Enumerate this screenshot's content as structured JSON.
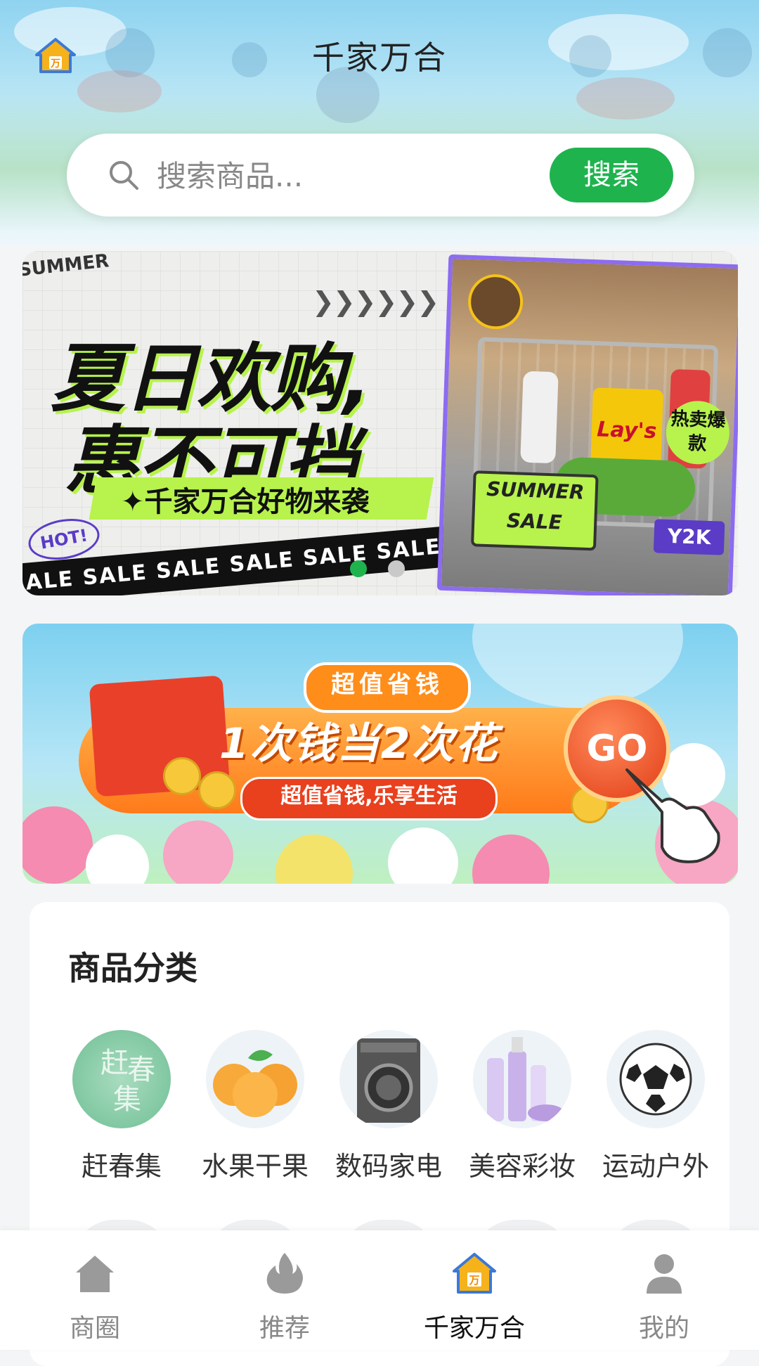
{
  "header": {
    "title": "千家万合",
    "logo_icon": "app-logo-icon"
  },
  "search": {
    "placeholder": "搜索商品...",
    "button_label": "搜索",
    "icon": "search-icon"
  },
  "banner_summer": {
    "tag": "SUMMER",
    "headline_line1": "夏日欢购,",
    "headline_line2": "惠不可挡",
    "subline": "✦千家万合好物来袭",
    "hot_badge": "HOT!",
    "tape_text": "SALE  SALE  SALE  SALE  SALE  SALE",
    "sign_text": "SUMMER SALE",
    "burst_text": "热卖爆款",
    "y2k_badge": "Y2K",
    "chip_brand": "Lay's",
    "accent_color": "#b7f34c",
    "frame_color": "#8c6cf0"
  },
  "carousel": {
    "slide_count": 2,
    "active_index": 0,
    "active_color": "#1fb34e",
    "inactive_color": "#c9c9c9"
  },
  "banner_save": {
    "top_badge": "超值省钱",
    "slogan": "1次钱当2次花",
    "sub_badge": "超值省钱,乐享生活",
    "go_label": "GO"
  },
  "categories": {
    "title": "商品分类",
    "items": [
      {
        "label": "赶春集",
        "icon": "spring-market-icon"
      },
      {
        "label": "水果干果",
        "icon": "fruit-icon"
      },
      {
        "label": "数码家电",
        "icon": "washing-machine-icon"
      },
      {
        "label": "美容彩妆",
        "icon": "cosmetics-icon"
      },
      {
        "label": "运动户外",
        "icon": "soccer-ball-icon"
      }
    ]
  },
  "tabbar": {
    "items": [
      {
        "label": "商圈",
        "icon": "home-icon",
        "active": false
      },
      {
        "label": "推荐",
        "icon": "flame-icon",
        "active": false
      },
      {
        "label": "千家万合",
        "icon": "app-logo-icon",
        "active": true
      },
      {
        "label": "我的",
        "icon": "user-icon",
        "active": false
      }
    ]
  },
  "colors": {
    "brand_green": "#1fb34e",
    "page_bg": "#f4f5f6"
  }
}
